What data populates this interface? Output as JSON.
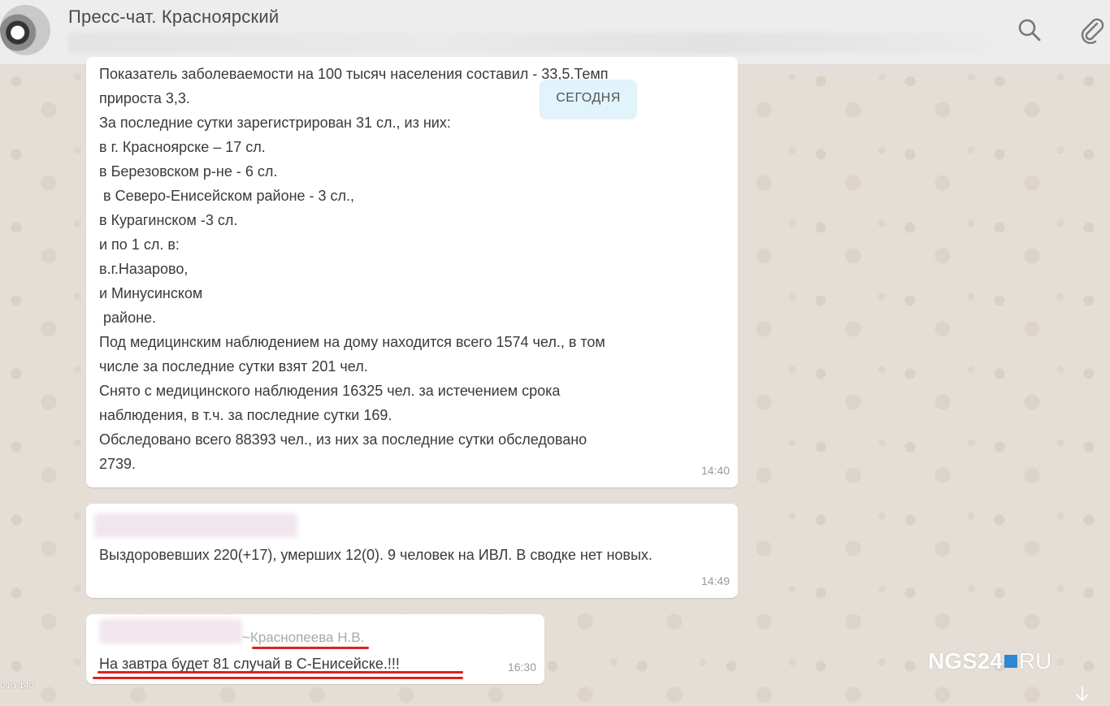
{
  "header": {
    "title": "Пресс-чат. Красноярский"
  },
  "date_badge": "СЕГОДНЯ",
  "messages": [
    {
      "lines": [
        "Показатель заболеваемости на 100 тысяч населения составил - 33,5.Темп",
        "прироста 3,3.",
        "За последние сутки зарегистрирован 31 сл., из них:",
        "в г. Красноярске – 17 сл.",
        "в Березовском р-не - 6 сл.",
        " в Северо-Енисейском районе - 3 сл.,",
        "в Курагинском -3 сл.",
        "и по 1 сл. в:",
        "в.г.Назарово,",
        "и Минусинском",
        " районе.",
        "Под медицинским наблюдением на дому находится всего 1574 чел., в том",
        "числе за последние сутки взят 201 чел.",
        "Снято с медицинского наблюдения 16325 чел. за истечением срока",
        "наблюдения, в т.ч. за последние сутки 169.",
        "Обследовано всего 88393 чел., из них за последние сутки обследовано",
        "2739."
      ],
      "time": "14:40"
    },
    {
      "text": "Выздоровевших 220(+17), умерших 12(0). 9 человек на ИВЛ. В сводке нет новых.",
      "time": "14:49"
    },
    {
      "sender": "~Краснопеева Н.В.",
      "text": "На завтра будет 81 случай в С-Енисейске.!!!",
      "time": "16:30"
    }
  ],
  "watermark": {
    "left": "NGS24",
    "right": "RU"
  },
  "counter": "0 из 140",
  "colors": {
    "underline": "#e02020",
    "badge_bg": "#e1f3fb",
    "watermark_square": "#2f87d4"
  },
  "icons": [
    "search-icon",
    "paperclip-icon",
    "arrow-down-icon"
  ]
}
